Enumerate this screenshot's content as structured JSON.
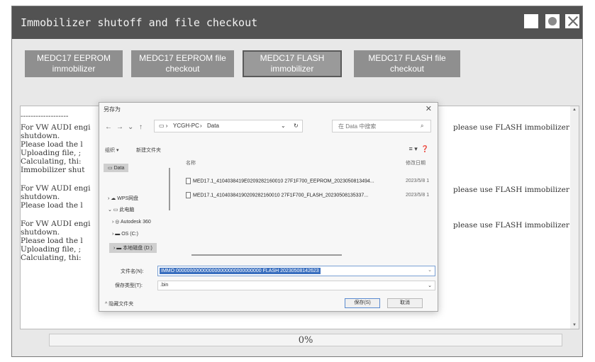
{
  "window": {
    "title": "Immobilizer shutoff and file checkout"
  },
  "toolbar": {
    "btn1_line1": "MEDC17 EEPROM",
    "btn1_line2": "immobilizer",
    "btn2_line1": "MEDC17 EEPROM file",
    "btn2_line2": "checkout",
    "btn3_line1": "MEDC17 FLASH",
    "btn3_line2": "immobilizer",
    "btn4_line1": "MEDC17 FLASH file",
    "btn4_line2": "checkout"
  },
  "log": {
    "sep": "-------------------",
    "l1": "For VW AUDI engi",
    "l2": "shutdown.",
    "l3": "Please load the l",
    "l4": "Uploading file, ;",
    "l5": "Calculating, thi:",
    "l6": "Immobilizer shut",
    "l7": "For VW AUDI engi",
    "l8": "shutdown.",
    "l9": "Please load the l",
    "l10": "For VW AUDI engi",
    "l11": "shutdown.",
    "l12": "Please load the l",
    "l13": "Uploading file, ;",
    "l14": "Calculating, thi:",
    "right": "please use FLASH immobilizer"
  },
  "progress": {
    "value": 0,
    "label": "0%"
  },
  "dialog": {
    "title": "另存为",
    "path_pc": "YCGH-PC",
    "path_sep": "›",
    "path_folder": "Data",
    "search_placeholder": "在 Data 中搜索",
    "organize": "组织 ▾",
    "new_folder": "新建文件夹",
    "col_name": "名称",
    "col_date": "修改日期",
    "nav_items": [
      "Data",
      "WPS网盘",
      "此电脑",
      "Autodesk 360",
      "OS (C:)",
      "本地磁盘 (D:)"
    ],
    "files": [
      {
        "name": "MED17.1_4104038419E0209282160010 27F1F700_EEPROM_20230508134​94...",
        "date": "2023/5/8 1"
      },
      {
        "name": "MED17.1_41040384190209282160010 27F1F700_FLASH_20230508135337...",
        "date": "2023/5/8 1"
      }
    ],
    "filename_label": "文件名(N):",
    "filename_value": "IMMO 0000000000000000000000000000000 FLASH 20230508142623",
    "filetype_label": "保存类型(T):",
    "filetype_value": ".bin",
    "hide_folders": "^ 隐藏文件夹",
    "save_label": "保存(S)",
    "cancel_label": "取消"
  }
}
